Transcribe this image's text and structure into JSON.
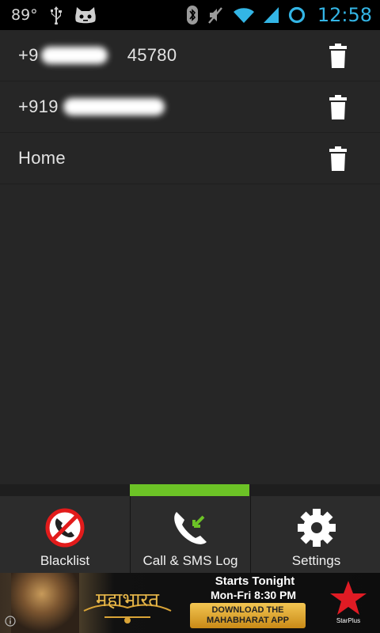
{
  "status_bar": {
    "temperature": "89°",
    "time": "12:58",
    "icons": [
      "usb-icon",
      "android-cat-icon",
      "bluetooth-icon",
      "mute-icon",
      "wifi-icon",
      "signal-icon",
      "battery-ring-icon"
    ]
  },
  "blacklist": {
    "entries": [
      {
        "number": "+9",
        "number_suffix": "45780",
        "redacted": true
      },
      {
        "number": "+919",
        "redacted": true
      },
      {
        "number": "Home",
        "redacted": false
      }
    ],
    "delete_icon": "trash-icon"
  },
  "tabs": {
    "active_index": 1,
    "items": [
      {
        "label": "Blacklist",
        "icon": "blocked-phone-icon"
      },
      {
        "label": "Call & SMS Log",
        "icon": "incoming-call-icon"
      },
      {
        "label": "Settings",
        "icon": "gear-icon"
      }
    ],
    "active_color": "#6cc326"
  },
  "ad": {
    "line1": "Starts Tonight",
    "line2": "Mon-Fri 8:30 PM",
    "button_line1": "DOWNLOAD THE",
    "button_line2": "MAHABHARAT APP",
    "brand": "StarPlus",
    "logo": "महाभारत"
  }
}
